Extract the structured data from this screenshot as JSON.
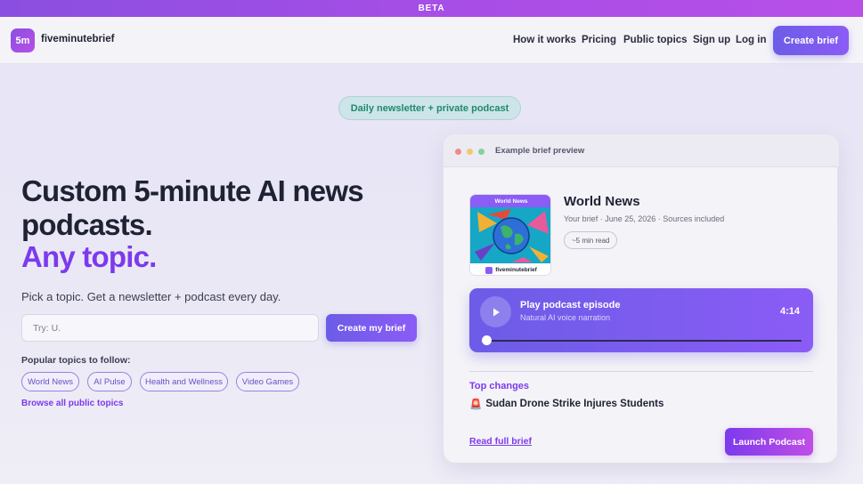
{
  "beta": {
    "label": "BETA"
  },
  "brand": {
    "logo_mark": "5m",
    "name": "fiveminutebrief"
  },
  "nav": {
    "links": [
      "How it works",
      "Pricing",
      "Public topics",
      "Sign up",
      "Log in"
    ],
    "cta": "Create brief"
  },
  "hero": {
    "pill": "Daily newsletter + private podcast",
    "title_line1": "Custom 5-minute AI news",
    "title_line2": "podcasts.",
    "accent": "Any topic.",
    "subtitle": "Pick a topic. Get a newsletter + podcast every day.",
    "input_value": "Try: U.",
    "submit": "Create my brief",
    "popular_label": "Popular topics to follow:",
    "topics": [
      "World News",
      "AI Pulse",
      "Health and Wellness",
      "Video Games"
    ],
    "browse": "Browse all public topics"
  },
  "preview": {
    "header": "Example brief preview",
    "cover_label": "World News",
    "cover_brand": "fiveminutebrief",
    "title": "World News",
    "meta": "Your brief · June 25, 2026 · Sources included",
    "read_time": "~5 min read",
    "player": {
      "title": "Play podcast episode",
      "subtitle": "Natural AI voice narration",
      "duration": "4:14",
      "progress": 0
    },
    "section": "Top changes",
    "headline_emoji": "🚨",
    "headline": "Sudan Drone Strike Injures Students",
    "read_full": "Read full brief",
    "launch": "Launch Podcast"
  },
  "colors": {
    "accent": "#7c3aed",
    "button": "#6c5ce7",
    "pill_text": "#1f8a6f",
    "dot_red": "#ef8b8b",
    "dot_yellow": "#f3c969",
    "dot_green": "#7fd39b"
  },
  "icons": [
    "logo-mark",
    "play-icon",
    "traffic-light-dots",
    "globe-illustration",
    "siren-emoji"
  ]
}
